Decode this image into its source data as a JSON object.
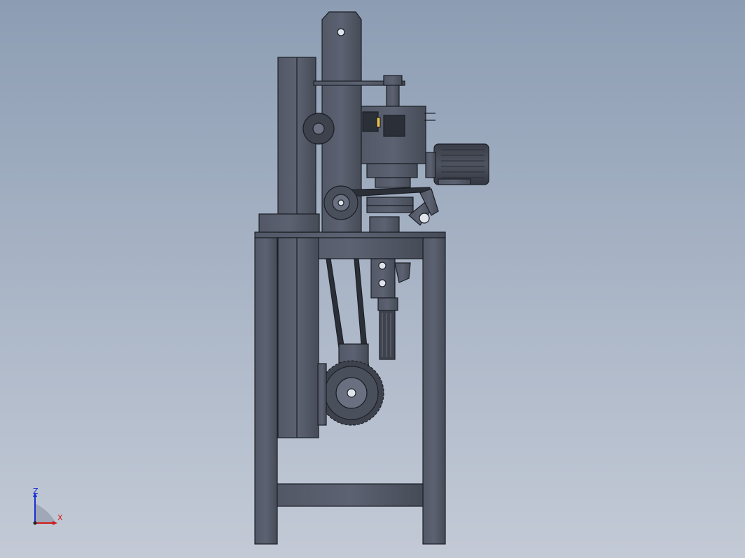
{
  "viewport": {
    "background_top": "#8c9db3",
    "background_bottom": "#c3cad6"
  },
  "model": {
    "body_color": "#4a4f5c",
    "edge_color": "#1c1f26",
    "accent_color": "#e8c24a"
  },
  "triad": {
    "z_label": "Z",
    "x_label": "X",
    "z_color": "#1a2fd0",
    "x_color": "#d01a1a"
  }
}
